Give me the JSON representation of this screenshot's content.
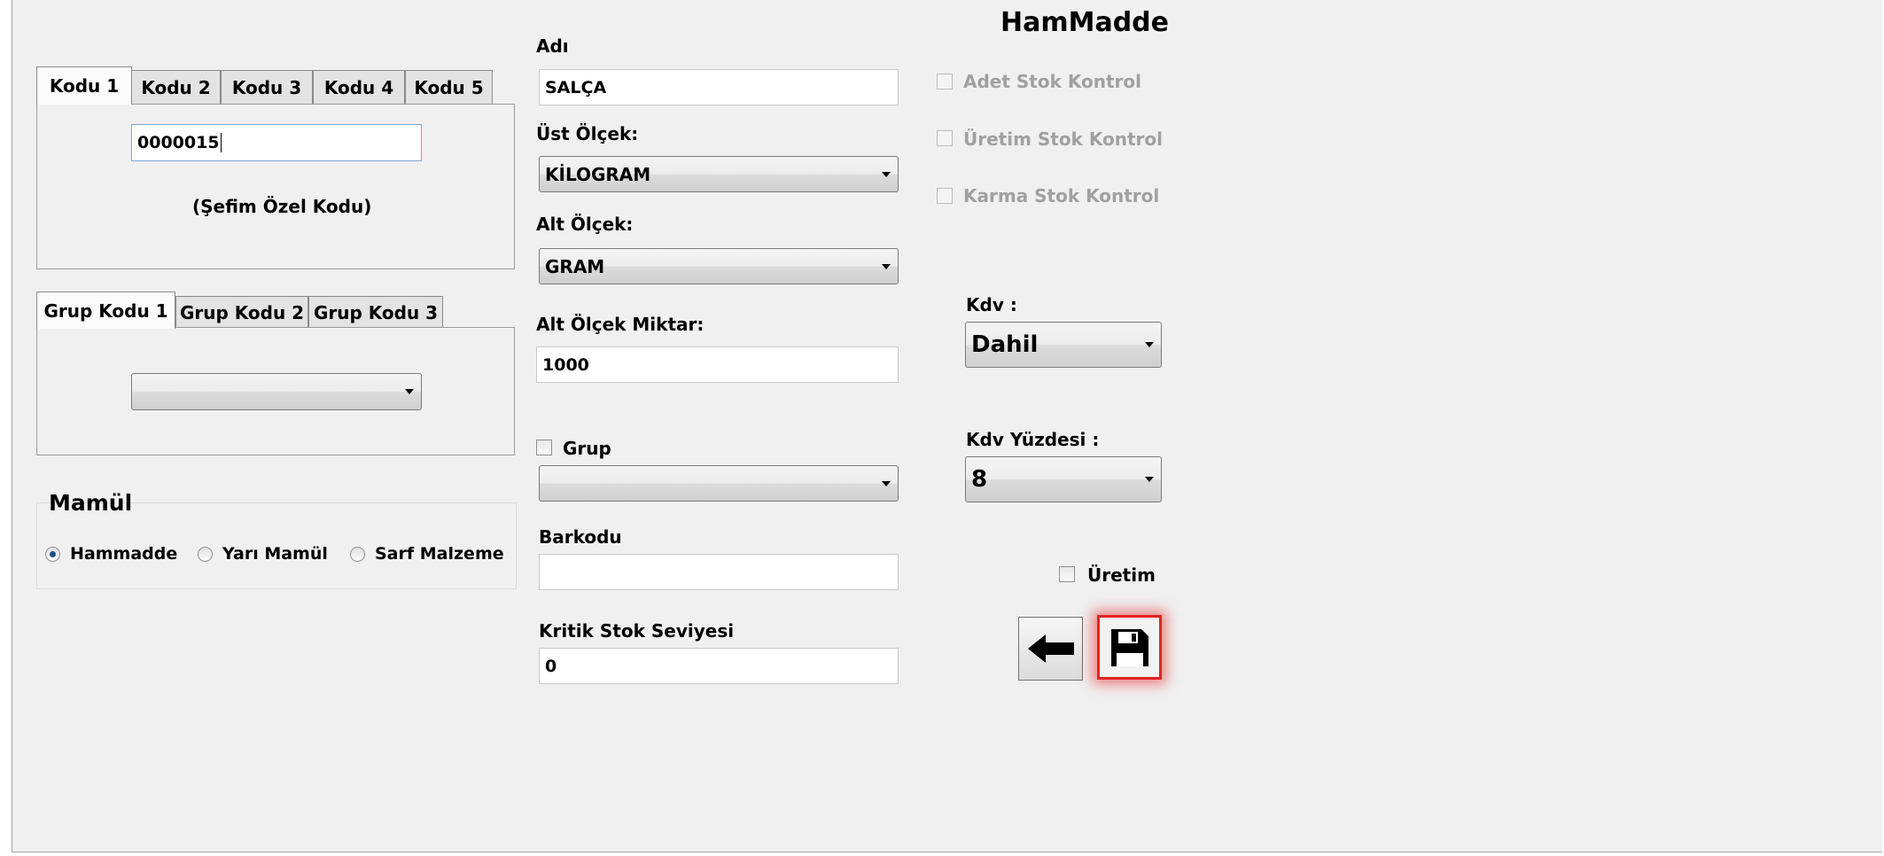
{
  "form": {
    "title": "HamMadde"
  },
  "code_tabs": {
    "tabs": [
      "Kodu 1",
      "Kodu 2",
      "Kodu 3",
      "Kodu 4",
      "Kodu 5"
    ],
    "value": "0000015",
    "caption": "(Şefim Özel Kodu)"
  },
  "group_tabs": {
    "tabs": [
      "Grup Kodu 1",
      "Grup Kodu 2",
      "Grup Kodu 3"
    ],
    "selected": ""
  },
  "mamul": {
    "title": "Mamül",
    "options": [
      "Hammadde",
      "Yarı Mamül",
      "Sarf Malzeme"
    ],
    "selected": "Hammadde"
  },
  "fields": {
    "adi_label": "Adı",
    "adi_value": "SALÇA",
    "ust_olcek_label": "Üst Ölçek:",
    "ust_olcek_value": "KİLOGRAM",
    "alt_olcek_label": "Alt Ölçek:",
    "alt_olcek_value": "GRAM",
    "alt_olcek_miktar_label": "Alt Ölçek Miktar:",
    "alt_olcek_miktar_value": "1000",
    "grup_label": "Grup",
    "grup_value": "",
    "barkodu_label": "Barkodu",
    "barkodu_value": "",
    "kritik_label": "Kritik Stok Seviyesi",
    "kritik_value": "0"
  },
  "stock_checks": {
    "items": [
      "Adet Stok Kontrol",
      "Üretim Stok Kontrol",
      "Karma Stok Kontrol"
    ],
    "enabled": false
  },
  "kdv": {
    "label": "Kdv :",
    "value": "Dahil",
    "yuzde_label": "Kdv Yüzdesi :",
    "yuzde_value": "8"
  },
  "uretim": {
    "label": "Üretim",
    "checked": false
  },
  "colors": {
    "background": "#f0f0f0",
    "save_highlight": "#e52222"
  },
  "icons": {
    "back": "arrow-left-icon",
    "save": "floppy-disk-icon"
  }
}
